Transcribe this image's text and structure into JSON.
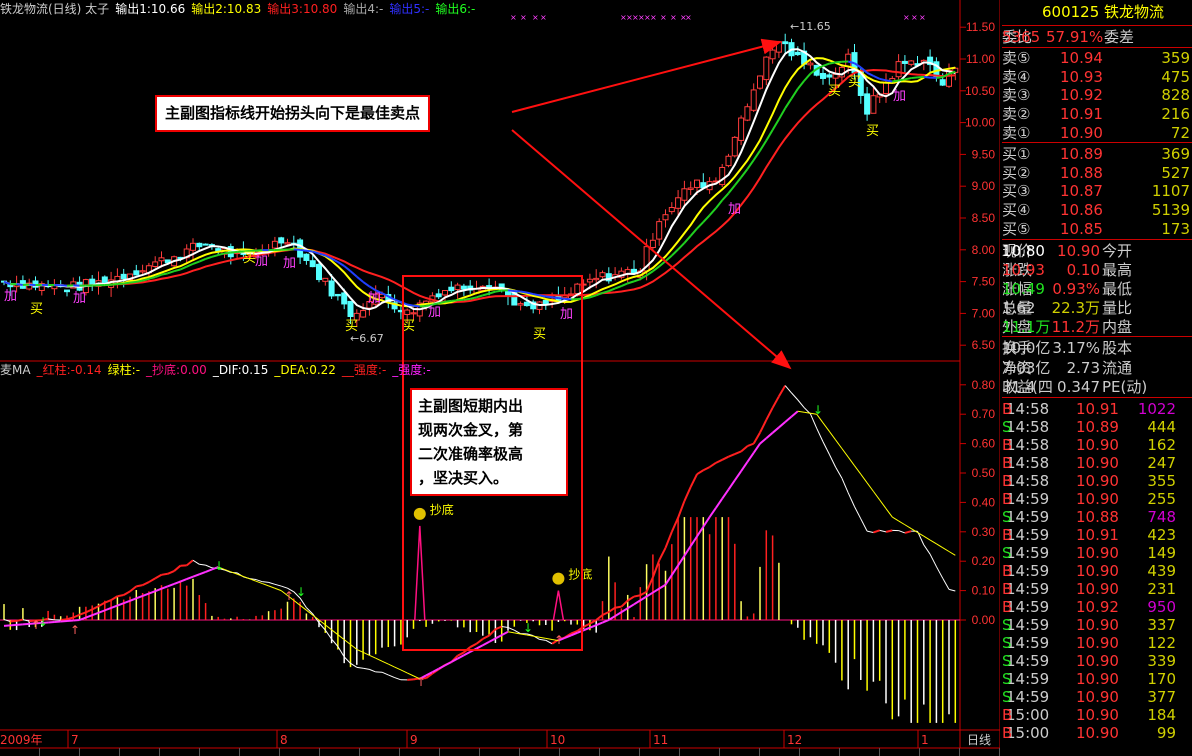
{
  "header": {
    "title": "铁龙物流(日线) 太子",
    "outputs": [
      {
        "label": "输出1:10.66",
        "color": "#ffffff"
      },
      {
        "label": "输出2:10.83",
        "color": "#ffff00"
      },
      {
        "label": "输出3:10.80",
        "color": "#ff2020"
      },
      {
        "label": "输出4:-",
        "color": "#aaaaaa"
      },
      {
        "label": "输出5:-",
        "color": "#3030ff"
      },
      {
        "label": "输出6:-",
        "color": "#20ff20"
      }
    ]
  },
  "indicator_header": [
    {
      "label": "麦MA",
      "color": "#cccccc"
    },
    {
      "label": "_红柱:-0.14",
      "color": "#ff2020"
    },
    {
      "label": "绿柱:-",
      "color": "#ffff00"
    },
    {
      "label": "_抄底:0.00",
      "color": "#ff1080"
    },
    {
      "label": "_DIF:0.15",
      "color": "#ffffff"
    },
    {
      "label": "_DEA:0.22",
      "color": "#ffff00"
    },
    {
      "label": "__强度:-",
      "color": "#ff2020"
    },
    {
      "label": "_强度:-",
      "color": "#ff20ff"
    }
  ],
  "price_axis": [
    "11.50",
    "11.00",
    "10.50",
    "10.00",
    "9.50",
    "9.00",
    "8.50",
    "8.00",
    "7.50",
    "7.00",
    "6.50"
  ],
  "ind_axis": [
    "0.80",
    "0.70",
    "0.60",
    "0.50",
    "0.40",
    "0.30",
    "0.20",
    "0.10",
    "0.00"
  ],
  "date_axis": {
    "year": "2009年",
    "months": [
      "7",
      "8",
      "9",
      "10",
      "11",
      "12",
      "1"
    ],
    "period": "日线"
  },
  "labels": {
    "high": "11.65",
    "low": "6.67",
    "buy": "买",
    "add": "加",
    "bottom": "抄底"
  },
  "notes": {
    "sell": "主副图指标线开始拐头向下是最佳卖点",
    "buy": [
      "主副图短期内出",
      "现两次金叉，第",
      "二次准确率极高",
      "，坚决买入。"
    ]
  },
  "quote": {
    "code": "600125",
    "name": "铁龙物流",
    "wb": {
      "l1": "委比",
      "v1": "57.91%",
      "l2": "委差",
      "v2": "5365"
    },
    "sell": [
      {
        "l": "卖⑤",
        "p": "10.94",
        "v": "359"
      },
      {
        "l": "卖④",
        "p": "10.93",
        "v": "475"
      },
      {
        "l": "卖③",
        "p": "10.92",
        "v": "828"
      },
      {
        "l": "卖②",
        "p": "10.91",
        "v": "216"
      },
      {
        "l": "卖①",
        "p": "10.90",
        "v": "72"
      }
    ],
    "buy": [
      {
        "l": "买①",
        "p": "10.89",
        "v": "369"
      },
      {
        "l": "买②",
        "p": "10.88",
        "v": "527"
      },
      {
        "l": "买③",
        "p": "10.87",
        "v": "1107"
      },
      {
        "l": "买④",
        "p": "10.86",
        "v": "5139"
      },
      {
        "l": "买⑤",
        "p": "10.85",
        "v": "173"
      }
    ],
    "stats": [
      {
        "l1": "现价",
        "v1": "10.90",
        "c1": "#ff3333",
        "l2": "今开",
        "v2": "10.80",
        "c2": "#ffffff"
      },
      {
        "l1": "涨跌",
        "v1": "0.10",
        "c1": "#ff3333",
        "l2": "最高",
        "v2": "10.93",
        "c2": "#ff3333"
      },
      {
        "l1": "涨幅",
        "v1": "0.93%",
        "c1": "#ff3333",
        "l2": "最低",
        "v2": "10.49",
        "c2": "#20e020"
      },
      {
        "l1": "总量",
        "v1": "22.3万",
        "c1": "#d0d000",
        "l2": "量比",
        "v2": "1.62",
        "c2": "#cccccc"
      },
      {
        "l1": "外盘",
        "v1": "11.2万",
        "c1": "#ff3333",
        "l2": "内盘",
        "v2": "11.1万",
        "c2": "#20e020"
      }
    ],
    "fin": [
      {
        "l1": "换手",
        "v1": "3.17%",
        "l2": "股本",
        "v2": "10.0亿"
      },
      {
        "l1": "净资",
        "v1": "2.73",
        "l2": "流通",
        "v2": "7.03亿"
      },
      {
        "l1": "收益(四",
        "v1": "0.347",
        "l2": "PE(动)",
        "v2": "31.4"
      }
    ],
    "ticks": [
      [
        "14:58",
        "10.91",
        "1022",
        "B"
      ],
      [
        "14:58",
        "10.89",
        "444",
        "S"
      ],
      [
        "14:58",
        "10.90",
        "162",
        "B"
      ],
      [
        "14:58",
        "10.90",
        "247",
        "B"
      ],
      [
        "14:58",
        "10.90",
        "355",
        "B"
      ],
      [
        "14:59",
        "10.90",
        "255",
        "B"
      ],
      [
        "14:59",
        "10.88",
        "748",
        "S"
      ],
      [
        "14:59",
        "10.91",
        "423",
        "B"
      ],
      [
        "14:59",
        "10.90",
        "149",
        "S"
      ],
      [
        "14:59",
        "10.90",
        "439",
        "B"
      ],
      [
        "14:59",
        "10.90",
        "231",
        "B"
      ],
      [
        "14:59",
        "10.92",
        "950",
        "B"
      ],
      [
        "14:59",
        "10.90",
        "337",
        "S"
      ],
      [
        "14:59",
        "10.90",
        "122",
        "S"
      ],
      [
        "14:59",
        "10.90",
        "339",
        "S"
      ],
      [
        "14:59",
        "10.90",
        "170",
        "S"
      ],
      [
        "14:59",
        "10.90",
        "377",
        "S"
      ],
      [
        "15:00",
        "10.90",
        "184",
        "B"
      ],
      [
        "15:00",
        "10.90",
        "99",
        "B"
      ]
    ]
  },
  "chart_data": {
    "type": "candlestick",
    "price_anchors": [
      [
        0,
        7.5
      ],
      [
        10,
        7.4
      ],
      [
        16,
        7.5
      ],
      [
        27,
        7.9
      ],
      [
        32,
        8.1
      ],
      [
        38,
        7.85
      ],
      [
        45,
        8.2
      ],
      [
        50,
        7.6
      ],
      [
        55,
        7.0
      ],
      [
        60,
        7.3
      ],
      [
        64,
        7.0
      ],
      [
        69,
        7.35
      ],
      [
        77,
        7.5
      ],
      [
        83,
        7.05
      ],
      [
        88,
        7.2
      ],
      [
        94,
        7.55
      ],
      [
        101,
        7.7
      ],
      [
        104,
        8.5
      ],
      [
        109,
        9.0
      ],
      [
        113,
        9.1
      ],
      [
        117,
        10.0
      ],
      [
        120,
        10.8
      ],
      [
        123,
        11.3
      ],
      [
        126,
        11.0
      ],
      [
        131,
        10.7
      ],
      [
        134,
        11.0
      ],
      [
        137,
        10.2
      ],
      [
        142,
        10.9
      ],
      [
        146,
        11.0
      ],
      [
        149,
        10.6
      ],
      [
        151,
        10.9
      ]
    ],
    "dif_anchors": [
      [
        0,
        0.0
      ],
      [
        10,
        0.0
      ],
      [
        30,
        0.2
      ],
      [
        38,
        0.15
      ],
      [
        46,
        0.1
      ],
      [
        55,
        -0.15
      ],
      [
        63,
        -0.2
      ],
      [
        67,
        -0.2
      ],
      [
        79,
        -0.02
      ],
      [
        87,
        -0.08
      ],
      [
        94,
        0.0
      ],
      [
        102,
        0.1
      ],
      [
        110,
        0.5
      ],
      [
        119,
        0.6
      ],
      [
        124,
        0.8
      ],
      [
        128,
        0.7
      ],
      [
        137,
        0.3
      ],
      [
        145,
        0.3
      ],
      [
        150,
        0.1
      ]
    ],
    "dea_anchors": [
      [
        0,
        -0.02
      ],
      [
        12,
        0.0
      ],
      [
        34,
        0.18
      ],
      [
        44,
        0.1
      ],
      [
        56,
        -0.1
      ],
      [
        66,
        -0.2
      ],
      [
        80,
        -0.04
      ],
      [
        88,
        -0.07
      ],
      [
        96,
        0.0
      ],
      [
        105,
        0.12
      ],
      [
        112,
        0.35
      ],
      [
        120,
        0.6
      ],
      [
        126,
        0.71
      ],
      [
        129,
        0.7
      ],
      [
        141,
        0.35
      ],
      [
        151,
        0.22
      ]
    ],
    "bottom_signals": [
      [
        66,
        0.32
      ],
      [
        88,
        0.1
      ]
    ]
  }
}
